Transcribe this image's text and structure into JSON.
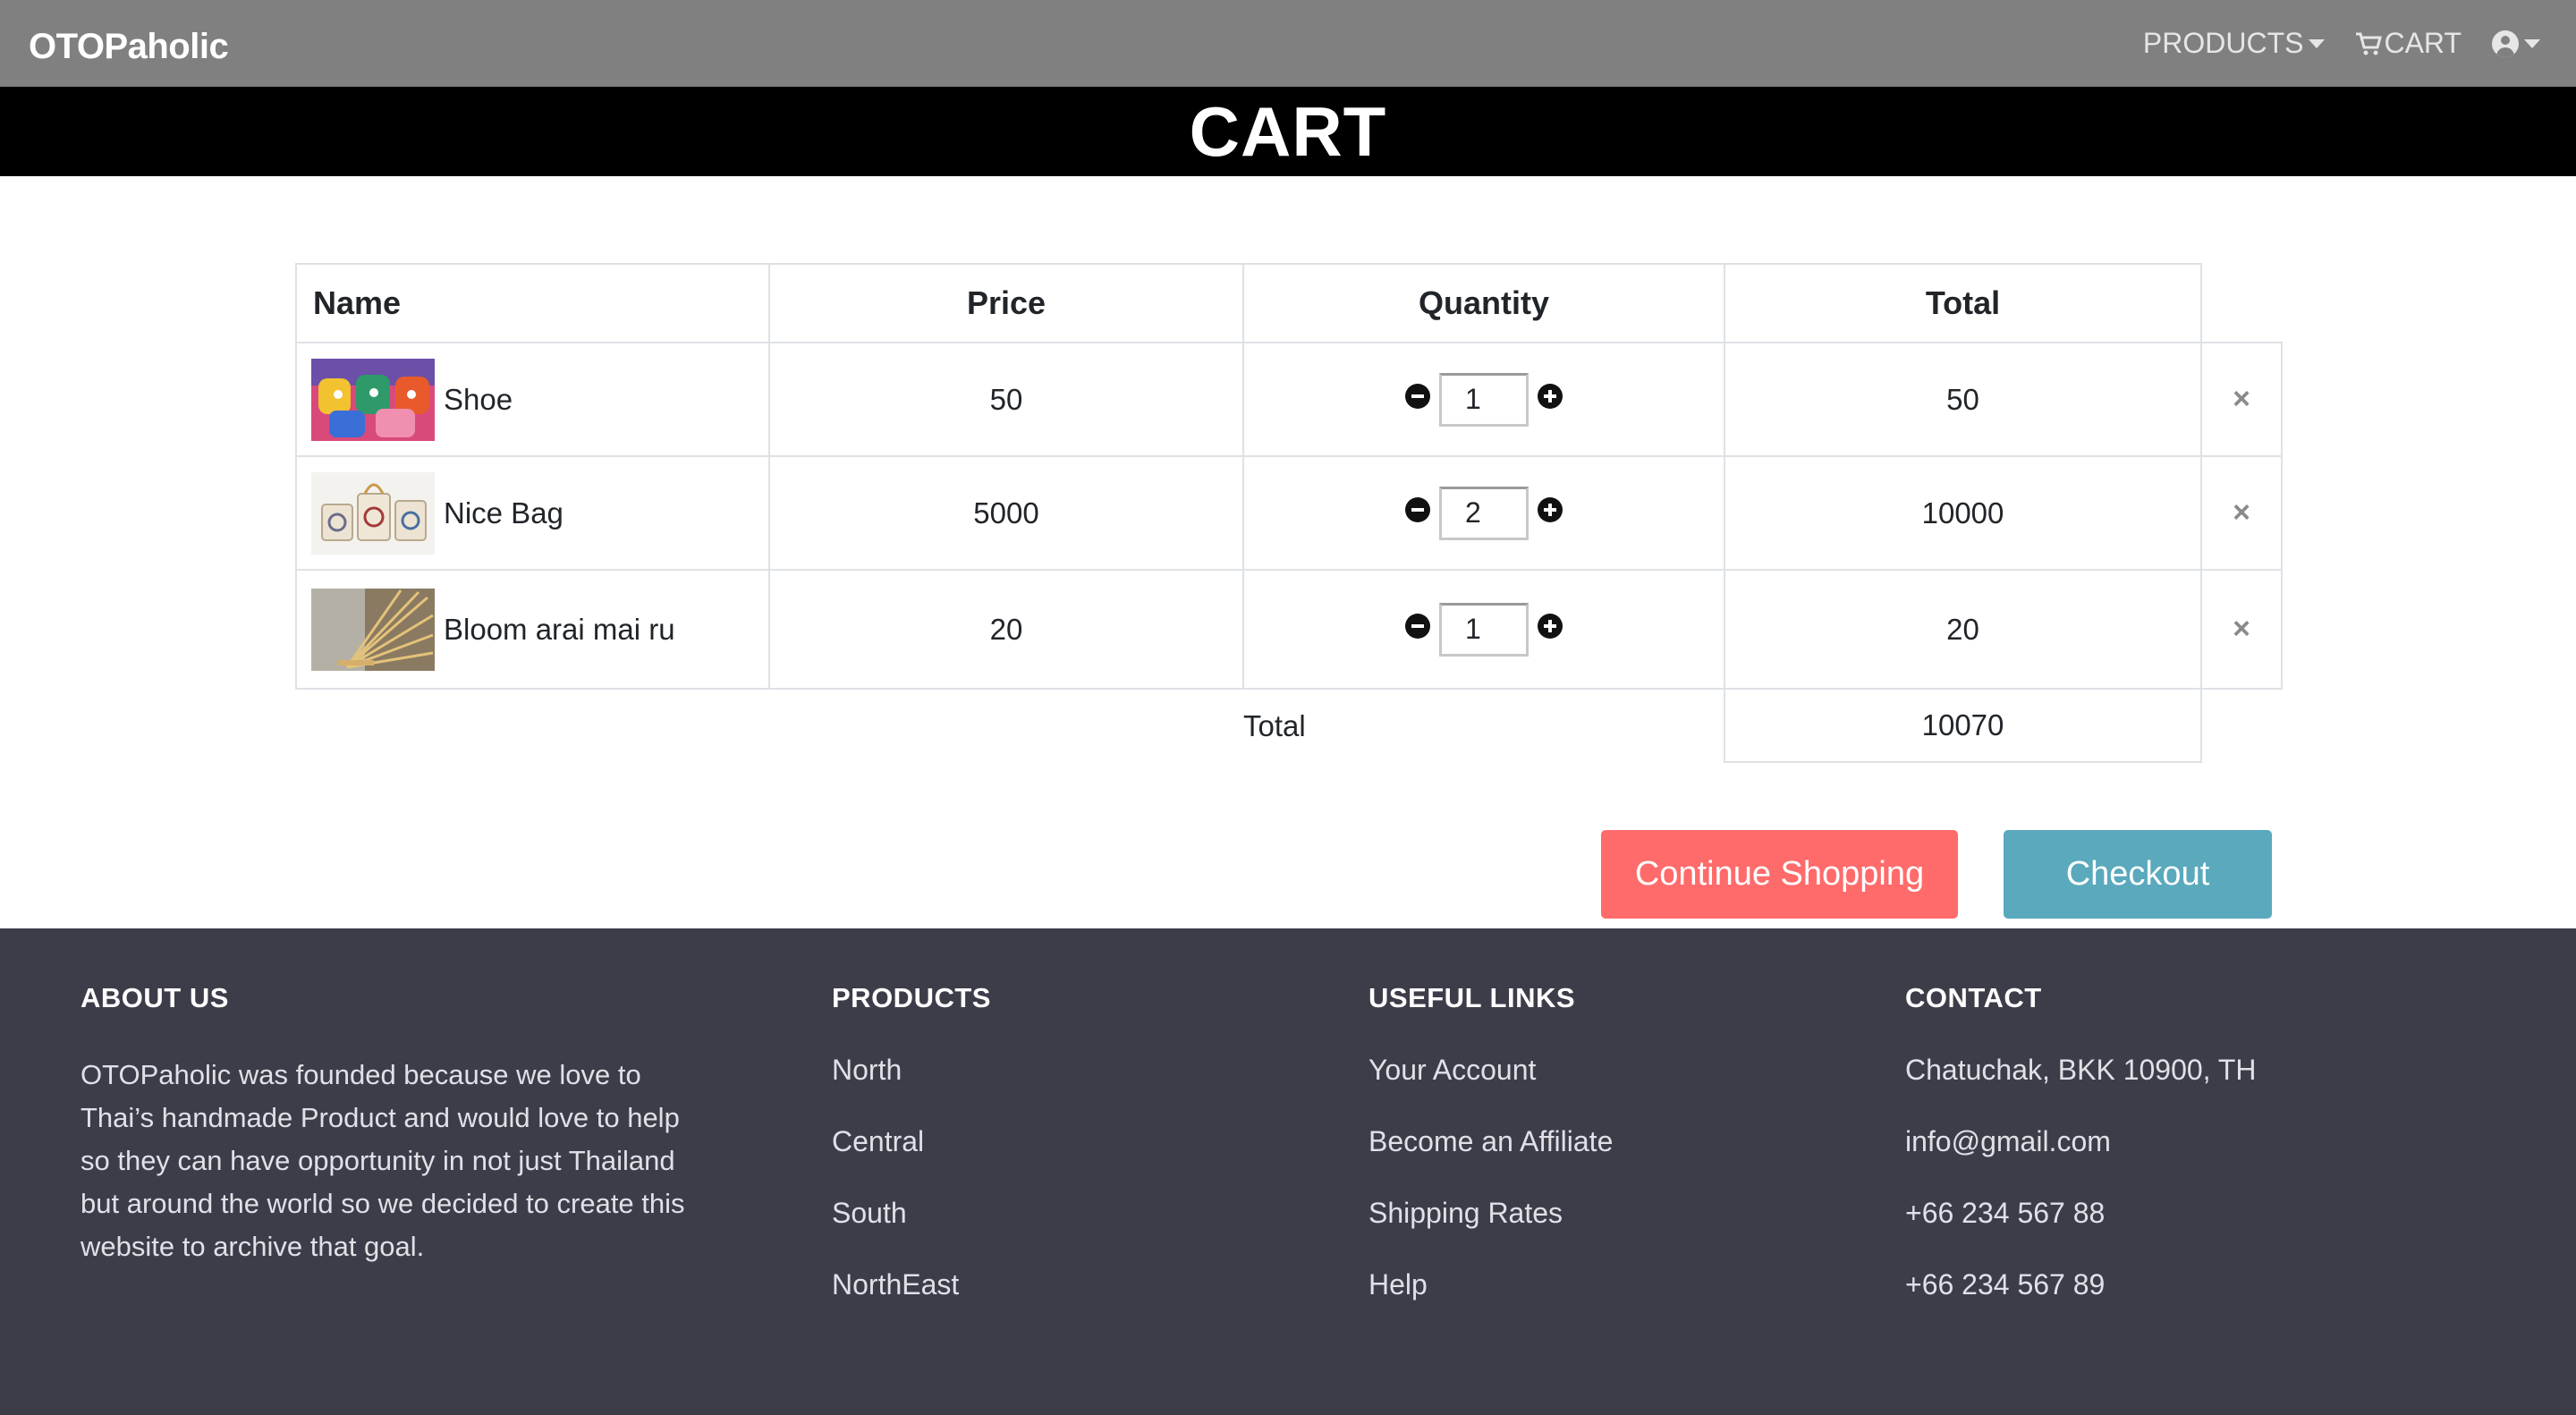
{
  "nav": {
    "brand": "OTOPaholic",
    "products_label": "PRODUCTS",
    "cart_label": "CART"
  },
  "page": {
    "title": "CART"
  },
  "table": {
    "headers": {
      "name": "Name",
      "price": "Price",
      "quantity": "Quantity",
      "total": "Total"
    },
    "items": [
      {
        "name": "Shoe",
        "price": "50",
        "quantity": "1",
        "total": "50"
      },
      {
        "name": "Nice Bag",
        "price": "5000",
        "quantity": "2",
        "total": "10000"
      },
      {
        "name": "Bloom arai mai ru",
        "price": "20",
        "quantity": "1",
        "total": "20"
      }
    ],
    "remove_symbol": "×",
    "summary_label": "Total",
    "summary_value": "10070"
  },
  "actions": {
    "continue_label": "Continue Shopping",
    "checkout_label": "Checkout"
  },
  "footer": {
    "about": {
      "heading": "ABOUT US",
      "text": "OTOPaholic was founded because we love to Thai’s handmade Product and would love to help so they can have opportunity in not just Thailand but around the world so we decided to create this website to archive that goal."
    },
    "products": {
      "heading": "PRODUCTS",
      "items": [
        "North",
        "Central",
        "South",
        "NorthEast"
      ]
    },
    "links": {
      "heading": "USEFUL LINKS",
      "items": [
        "Your Account",
        "Become an Affiliate",
        "Shipping Rates",
        "Help"
      ]
    },
    "contact": {
      "heading": "CONTACT",
      "items": [
        "Chatuchak, BKK 10900, TH",
        "info@gmail.com",
        "+66 234 567 88",
        "+66 234 567 89"
      ]
    }
  },
  "colors": {
    "navbar": "#808080",
    "title_band": "#000000",
    "continue_button": "#ff6b6b",
    "checkout_button": "#5aa9bd",
    "footer": "#3d3d4a"
  },
  "icons": [
    "cart-icon",
    "user-icon",
    "minus-icon",
    "plus-icon",
    "close-icon"
  ]
}
